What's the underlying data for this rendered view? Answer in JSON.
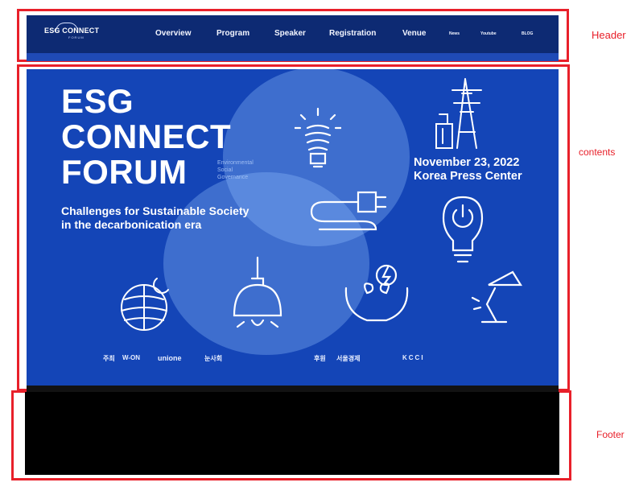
{
  "annotations": {
    "header": "Header",
    "contents": "contents",
    "footer": "Footer"
  },
  "header": {
    "logo_text": "ESG CONNECT",
    "logo_sub": "FORUM",
    "nav": [
      {
        "label": "Overview"
      },
      {
        "label": "Program"
      },
      {
        "label": "Speaker"
      },
      {
        "label": "Registration"
      },
      {
        "label": "Venue"
      },
      {
        "label": "News"
      },
      {
        "label": "Youtube"
      },
      {
        "label": "BLOG"
      }
    ]
  },
  "hero": {
    "title_lines": [
      "ESG",
      "CONNECT",
      "FORUM"
    ],
    "tagline_lines": [
      "Environmental",
      "Social",
      "Governance"
    ],
    "subtitle_lines": [
      "Challenges for Sustainable Society",
      "in the decarbonication era"
    ],
    "date": "November 23, 2022",
    "venue": "Korea Press Center",
    "sponsors": {
      "host_prefix": "주최",
      "hosts": [
        "W-ON",
        "unione",
        "눈사회"
      ],
      "support_prefix": "후원",
      "supporters": [
        "서울경제",
        "KCCI"
      ]
    }
  },
  "colors": {
    "annotation_red": "#e8202a",
    "header_navy": "#0d2a73",
    "hero_blue": "#1445b7",
    "footer_black": "#000000"
  }
}
